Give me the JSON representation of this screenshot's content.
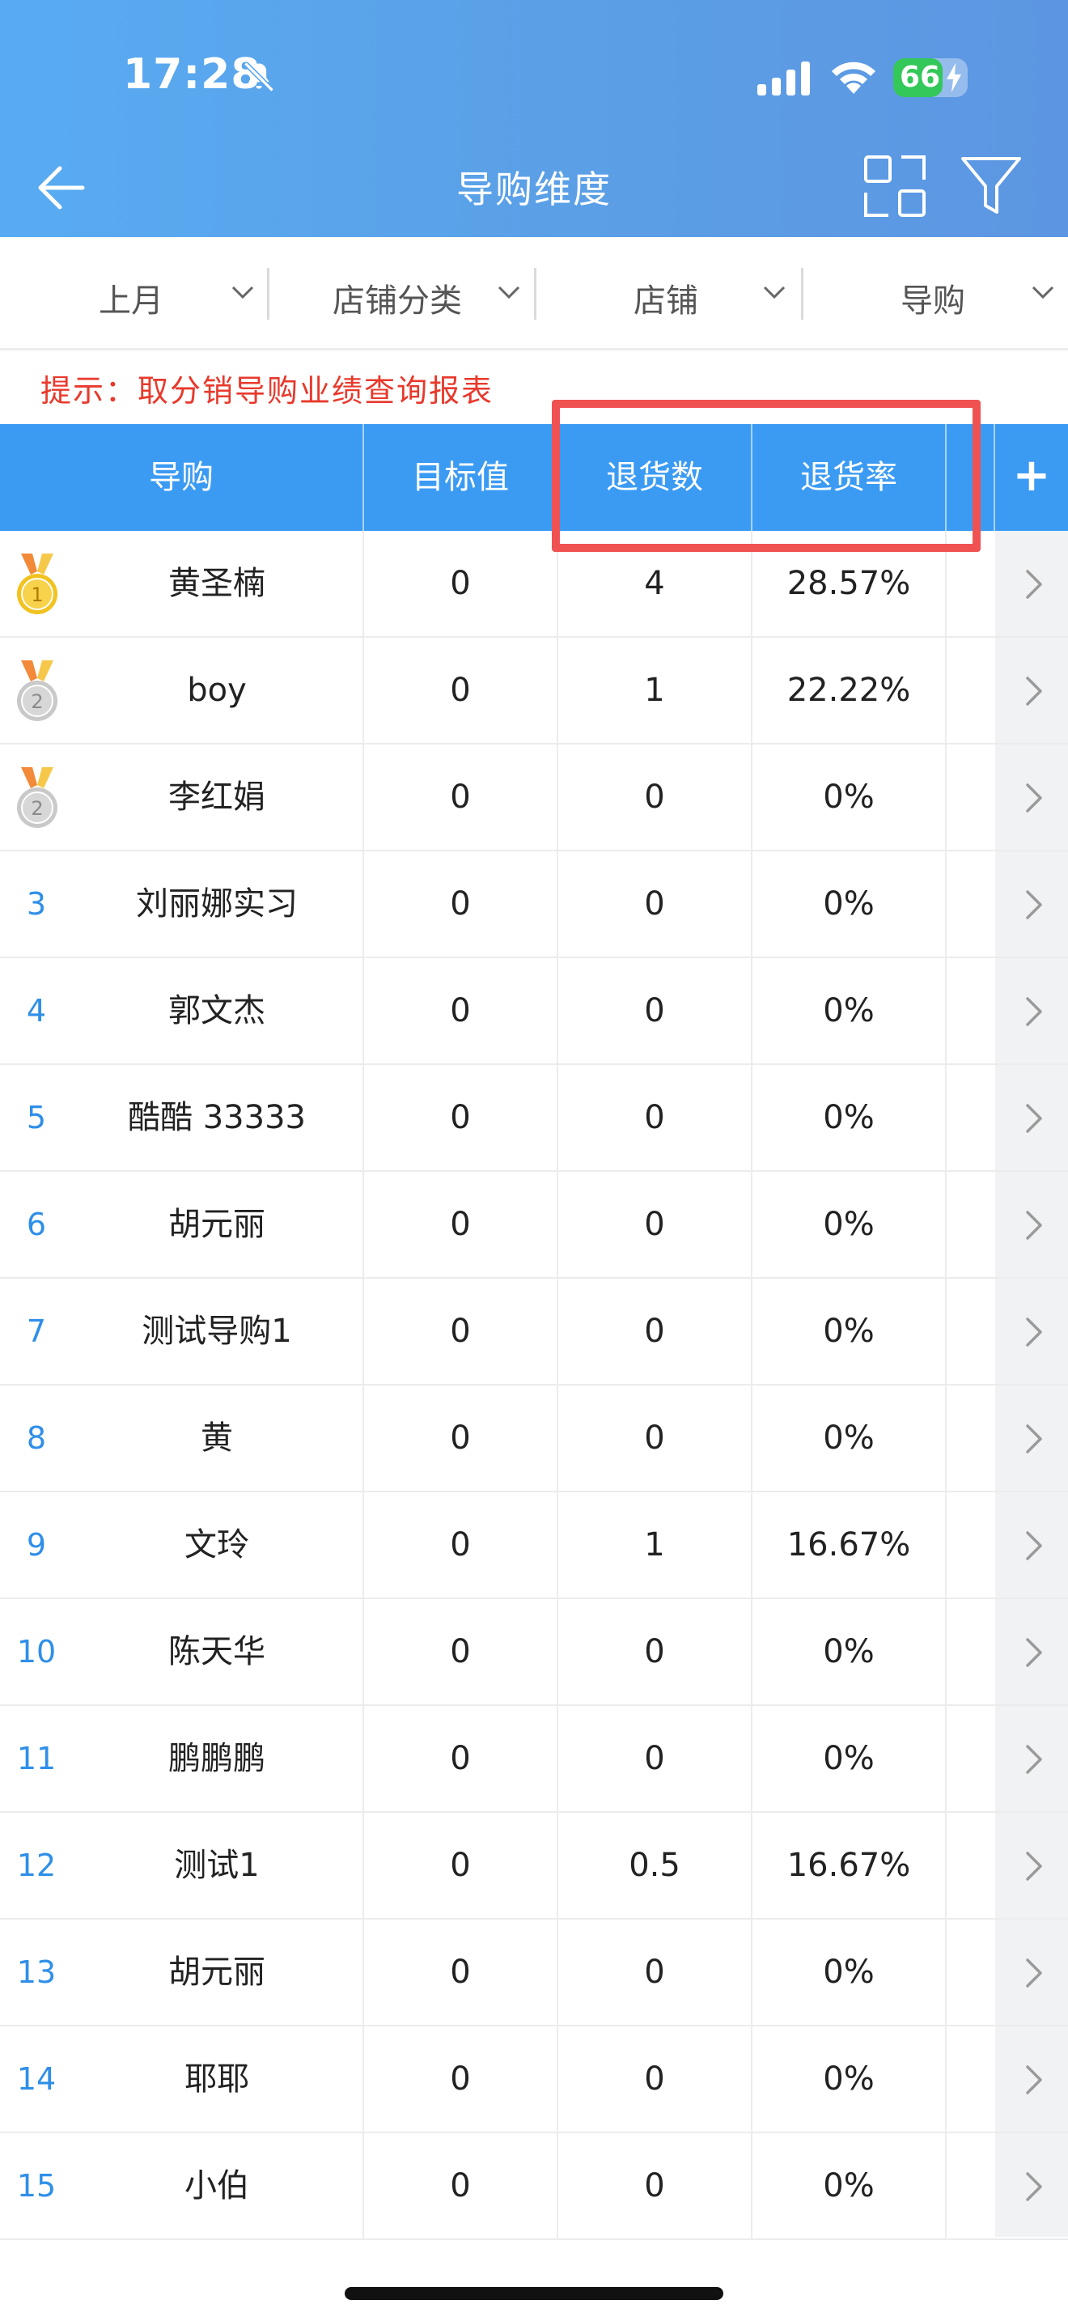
{
  "status_bar": {
    "time": "17:28",
    "battery": "66"
  },
  "nav": {
    "title": "导购维度"
  },
  "filters": [
    {
      "label": "上月"
    },
    {
      "label": "店铺分类"
    },
    {
      "label": "店铺"
    },
    {
      "label": "导购"
    }
  ],
  "tip": "提示：取分销导购业绩查询报表",
  "table": {
    "columns": [
      "导购",
      "目标值",
      "退货数",
      "退货率"
    ],
    "add_column_label": "+",
    "rows": [
      {
        "rank": "1",
        "medal": "gold",
        "name": "黄圣楠",
        "target": "0",
        "returns": "4",
        "rate": "28.57%"
      },
      {
        "rank": "2",
        "medal": "silver",
        "name": "boy",
        "target": "0",
        "returns": "1",
        "rate": "22.22%"
      },
      {
        "rank": "2",
        "medal": "silver",
        "name": "李红娟",
        "target": "0",
        "returns": "0",
        "rate": "0%"
      },
      {
        "rank": "3",
        "name": "刘丽娜实习",
        "target": "0",
        "returns": "0",
        "rate": "0%"
      },
      {
        "rank": "4",
        "name": "郭文杰",
        "target": "0",
        "returns": "0",
        "rate": "0%"
      },
      {
        "rank": "5",
        "name": "酷酷 33333",
        "target": "0",
        "returns": "0",
        "rate": "0%"
      },
      {
        "rank": "6",
        "name": "胡元丽",
        "target": "0",
        "returns": "0",
        "rate": "0%"
      },
      {
        "rank": "7",
        "name": "测试导购1",
        "target": "0",
        "returns": "0",
        "rate": "0%"
      },
      {
        "rank": "8",
        "name": "黄",
        "target": "0",
        "returns": "0",
        "rate": "0%"
      },
      {
        "rank": "9",
        "name": "文玲",
        "target": "0",
        "returns": "1",
        "rate": "16.67%"
      },
      {
        "rank": "10",
        "name": "陈天华",
        "target": "0",
        "returns": "0",
        "rate": "0%"
      },
      {
        "rank": "11",
        "name": "鹏鹏鹏",
        "target": "0",
        "returns": "0",
        "rate": "0%"
      },
      {
        "rank": "12",
        "name": "测试1",
        "target": "0",
        "returns": "0.5",
        "rate": "16.67%"
      },
      {
        "rank": "13",
        "name": "胡元丽",
        "target": "0",
        "returns": "0",
        "rate": "0%"
      },
      {
        "rank": "14",
        "name": "耶耶",
        "target": "0",
        "returns": "0",
        "rate": "0%"
      },
      {
        "rank": "15",
        "name": "小伯",
        "target": "0",
        "returns": "0",
        "rate": "0%"
      }
    ]
  },
  "colors": {
    "header_bg": "#5ba6f0",
    "table_header_bg": "#3b9bf3",
    "tip": "#e8392c",
    "rank": "#2f8fe8",
    "highlight": "#f05252"
  },
  "icons": [
    "bell-off-icon",
    "signal-icon",
    "wifi-icon",
    "battery-icon",
    "back-arrow-icon",
    "rotate-screen-icon",
    "filter-icon",
    "chevron-down-icon",
    "chevron-right-icon",
    "medal-icon",
    "plus-icon"
  ]
}
